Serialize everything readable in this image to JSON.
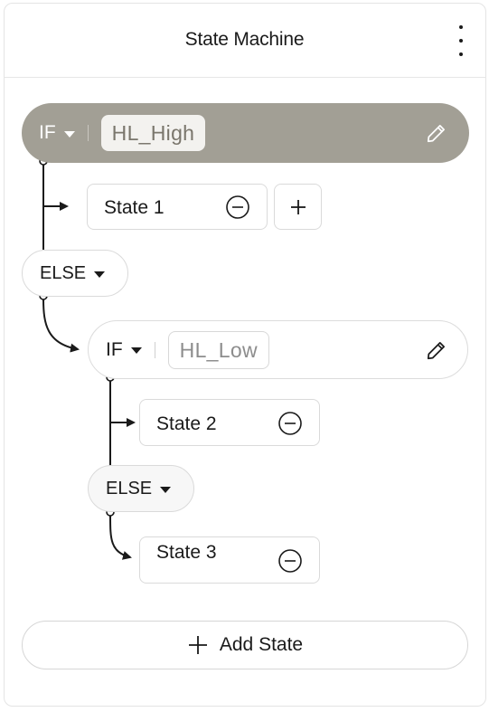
{
  "header": {
    "title": "State Machine",
    "menu_icon": "more-vertical-icon"
  },
  "tree": {
    "if_block_1": {
      "keyword": "IF",
      "variable": "HL_High",
      "edit_icon": "pencil-icon"
    },
    "state_1": {
      "label": "State 1",
      "remove_icon": "minus-circle-icon",
      "add_icon": "plus-icon"
    },
    "else_1": {
      "keyword": "ELSE"
    },
    "if_block_2": {
      "keyword": "IF",
      "variable": "HL_Low",
      "edit_icon": "pencil-icon"
    },
    "state_2": {
      "label": "State 2",
      "remove_icon": "minus-circle-icon"
    },
    "else_2": {
      "keyword": "ELSE"
    },
    "state_3": {
      "label": "State 3",
      "remove_icon": "minus-circle-icon"
    }
  },
  "footer": {
    "add_state_label": "Add State",
    "add_icon": "plus-icon"
  },
  "colors": {
    "active_if_bg": "#a29f95",
    "chip_bg": "#f3f2ef",
    "border": "#dadada",
    "text": "#1a1a1a"
  }
}
